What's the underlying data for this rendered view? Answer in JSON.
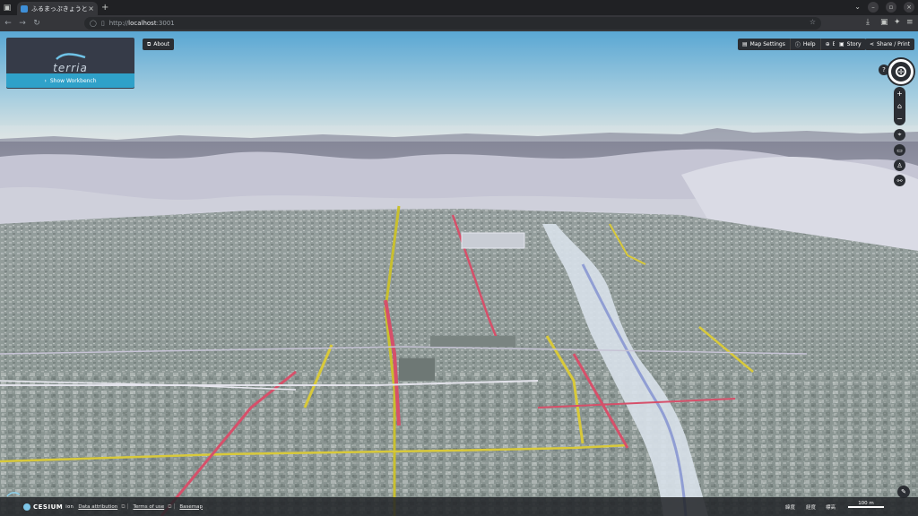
{
  "browser": {
    "tab_title": "ふるまっぷきょうと",
    "tab_close": "×",
    "new_tab": "+",
    "url_prefix": "http://",
    "url_host": "localhost",
    "url_port": ":3001"
  },
  "app": {
    "logo_text": "terria",
    "workbench_label": "Show Workbench",
    "about_label": "About",
    "menu": [
      {
        "label": "Map Settings",
        "icon": "map-settings-icon"
      },
      {
        "label": "Help",
        "icon": "help-icon"
      },
      {
        "label": "EN",
        "icon": "globe-icon"
      }
    ],
    "story_label": "Story",
    "share_label": "Share / Print",
    "help_glyph": "?"
  },
  "bottom_bar": {
    "cesium_label": "CESIUM",
    "cesium_suffix": "ion",
    "data_attribution": "Data attribution",
    "terms_of_use": "Terms of use",
    "basemap": "Basemap",
    "coord_lat": "緯度",
    "coord_lon": "経度",
    "coord_elev": "標高",
    "scale_label": "100 m"
  },
  "colors": {
    "accent": "#2fa1c9",
    "panel": "#2b2e33",
    "sky_top": "#5aa7d3",
    "sky_bottom": "#dfe7ea"
  }
}
